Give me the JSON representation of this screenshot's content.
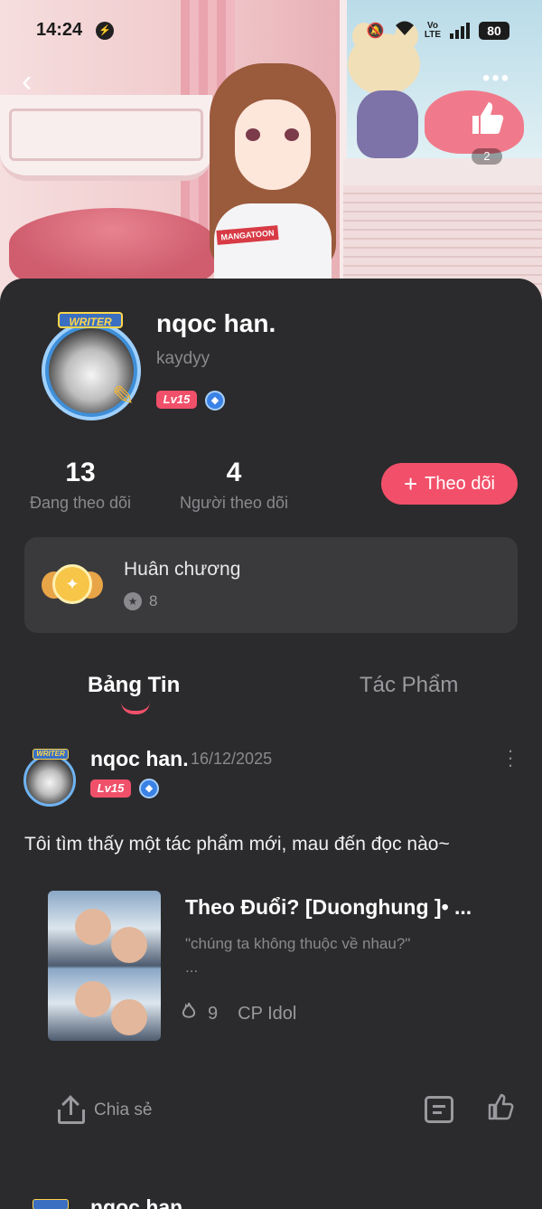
{
  "status_bar": {
    "time": "14:24",
    "network": "LTE",
    "volte": "Vo",
    "battery": "80",
    "icons": [
      "messenger-icon",
      "mute-bell-icon",
      "wifi-icon",
      "signal-icon"
    ]
  },
  "hero": {
    "shirt_text": "MANGATOON",
    "like_count": "2"
  },
  "profile": {
    "name": "nqoc han.",
    "handle": "kaydyy",
    "level": "Lv15",
    "avatar_badge": "WRITER",
    "following_count": "13",
    "following_label": "Đang theo dõi",
    "followers_count": "4",
    "followers_label": "Người theo dõi",
    "follow_button": "Theo dõi"
  },
  "medals": {
    "title": "Huân chương",
    "count": "8"
  },
  "tabs": [
    {
      "label": "Bảng Tin",
      "active": true
    },
    {
      "label": "Tác Phẩm",
      "active": false
    }
  ],
  "post": {
    "author": "nqoc han.",
    "date": "16/12/2025",
    "level": "Lv15",
    "avatar_badge": "WRITER",
    "text": "Tôi tìm thấy một tác phẩm mới, mau đến đọc nào~",
    "work": {
      "title": "Theo Đuổi? [Duonghung ]• ...",
      "description": "\"chúng ta không thuộc về nhau?\"\n...",
      "hot_count": "9",
      "genre": "CP Idol"
    },
    "share_label": "Chia sẻ"
  },
  "next_post": {
    "author": "nqoc han."
  },
  "colors": {
    "accent": "#f2506a",
    "background": "#2b2b2d",
    "card": "#3a3a3c",
    "muted_text": "#8a8a8e"
  }
}
